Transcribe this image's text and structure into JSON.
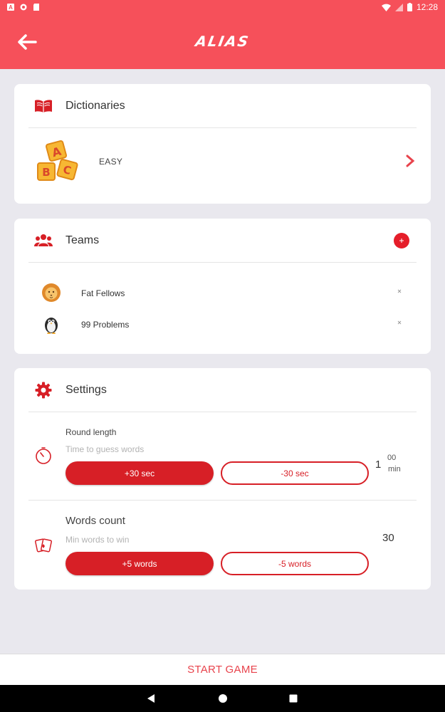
{
  "status_bar": {
    "time": "12:28",
    "left_icons": [
      "a-icon",
      "circle-icon",
      "sd-card-icon"
    ],
    "right_icons": [
      "wifi-icon",
      "signal-icon",
      "battery-icon"
    ]
  },
  "app_bar": {
    "title": "ALIAS",
    "back_icon": "arrow-left-icon",
    "color": "#f6505a"
  },
  "dictionaries": {
    "title": "Dictionaries",
    "icon": "book-icon",
    "selected": {
      "label": "EASY",
      "image": "abc-blocks-icon"
    }
  },
  "teams": {
    "title": "Teams",
    "icon": "group-icon",
    "items": [
      {
        "name": "Fat Fellows",
        "avatar": "lion-icon"
      },
      {
        "name": "99 Problems",
        "avatar": "penguin-icon"
      }
    ]
  },
  "settings": {
    "title": "Settings",
    "icon": "gear-icon",
    "round_length": {
      "title": "Round length",
      "subtitle": "Time to guess words",
      "icon": "timer-icon",
      "plus_label": "+30 sec",
      "minus_label": "-30 sec",
      "value_minutes": "1",
      "value_seconds": "00",
      "unit": "min"
    },
    "words_count": {
      "title": "Words count",
      "subtitle": "Min words to win",
      "icon": "cards-icon",
      "plus_label": "+5 words",
      "minus_label": "-5 words",
      "value": "30"
    }
  },
  "start_button": "START GAME",
  "colors": {
    "accent": "#d71f26",
    "header": "#f6505a",
    "background": "#e9e8ee"
  }
}
